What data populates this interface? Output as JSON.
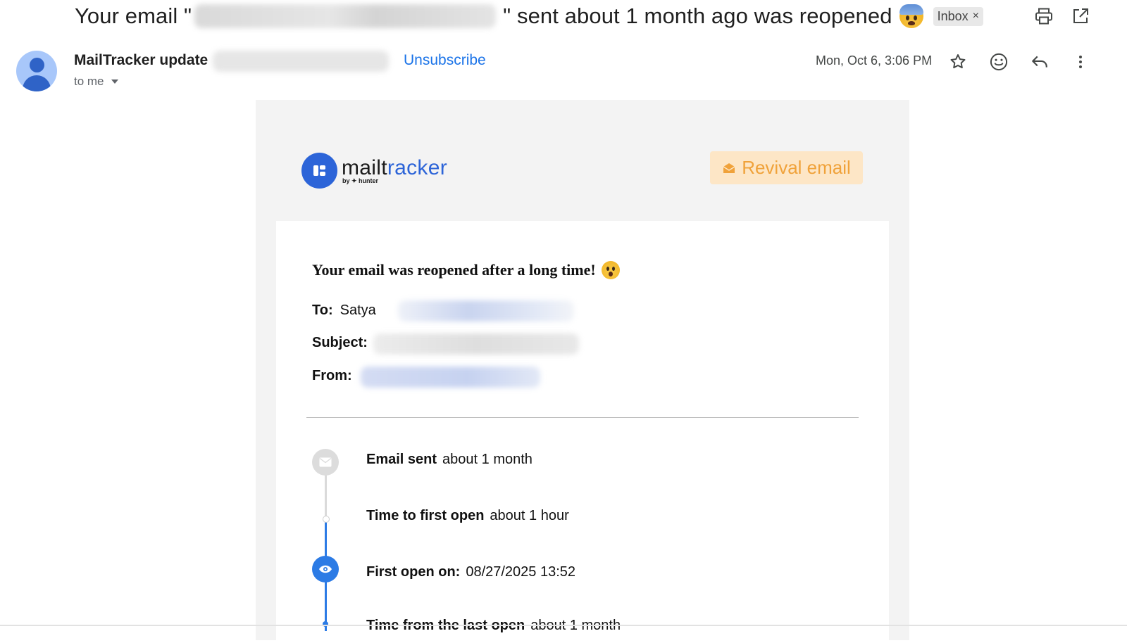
{
  "subject": {
    "prefix": "Your email \"",
    "suffix": "\" sent about 1 month ago was reopened",
    "label_chip": "Inbox",
    "chip_close": "×"
  },
  "toolbar": {
    "print_icon": "printer-icon",
    "open_new_window_icon": "open-in-new-icon"
  },
  "sender": {
    "name": "MailTracker update",
    "unsubscribe": "Unsubscribe",
    "recipient": "to me",
    "date": "Mon, Oct 6, 3:06 PM",
    "icons": [
      "star-icon",
      "emoji-icon",
      "reply-icon",
      "more-vert-icon"
    ]
  },
  "mail": {
    "logo": {
      "word_plain": "mailt",
      "word_accent": "racker",
      "byline": "by ✦ hunter"
    },
    "revival_button": "Revival email",
    "heading": "Your email was reopened after a long time!",
    "fields": {
      "to_label": "To:",
      "to_value": "Satya",
      "subject_label": "Subject:",
      "from_label": "From:"
    },
    "timeline": [
      {
        "label": "Email sent",
        "value": "about 1 month"
      },
      {
        "label": "Time to first open",
        "value": "about 1 hour"
      },
      {
        "label": "First open on:",
        "value": "08/27/2025 13:52"
      },
      {
        "label": "Time from the last open",
        "value": "about 1 month"
      }
    ]
  },
  "colors": {
    "accent_blue": "#1a73e8",
    "brand_blue": "#2c64d8",
    "revival_bg": "#fde6c6",
    "revival_text": "#f0a23a"
  }
}
